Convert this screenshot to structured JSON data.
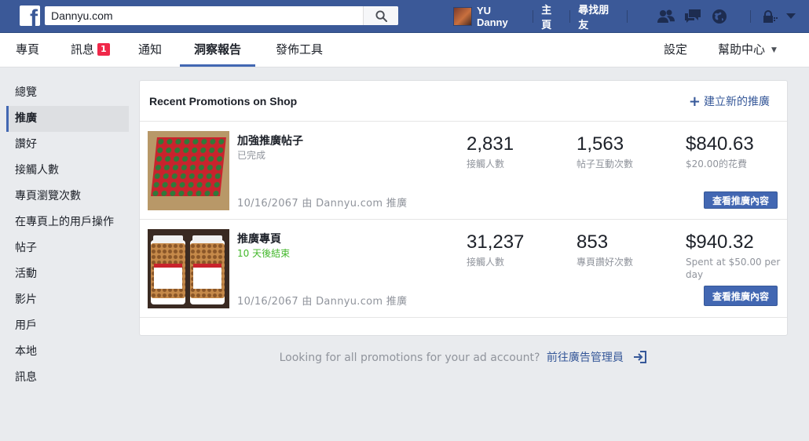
{
  "topbar": {
    "logo": "f",
    "search_value": "Dannyu.com",
    "user_name": "YU Danny",
    "home_label": "主頁",
    "find_friends_label": "尋找朋友"
  },
  "nav": {
    "tabs": [
      "專頁",
      "訊息",
      "通知",
      "洞察報告",
      "發佈工具"
    ],
    "message_badge": "1",
    "settings_label": "設定",
    "help_label": "幫助中心",
    "caret": "▼"
  },
  "sidebar": {
    "items": [
      "總覽",
      "推廣",
      "讚好",
      "接觸人數",
      "專頁瀏覽次數",
      "在專頁上的用戶操作",
      "帖子",
      "活動",
      "影片",
      "用戶",
      "本地",
      "訊息"
    ]
  },
  "card": {
    "title": "Recent Promotions on Shop",
    "create_plus": "+",
    "create_label": "建立新的推廣",
    "promotions": [
      {
        "title": "加強推廣帖子",
        "status": "已完成",
        "date": "10/16/2067 由 Dannyu.com 推廣",
        "reach_value": "2,831",
        "reach_label": "接觸人數",
        "metric2_value": "1,563",
        "metric2_label": "帖子互動次數",
        "spend_value": "$840.63",
        "spend_label": "$20.00的花費",
        "button_label": "查看推廣內容"
      },
      {
        "title": "推廣專頁",
        "status": "10 天後結束",
        "date": "10/16/2067 由 Dannyu.com 推廣",
        "reach_value": "31,237",
        "reach_label": "接觸人數",
        "metric2_value": "853",
        "metric2_label": "專頁讚好次數",
        "spend_value": "$940.32",
        "spend_label": "Spent at $50.00 per day",
        "button_label": "查看推廣內容"
      }
    ]
  },
  "footer": {
    "text": "Looking for all promotions for your ad account?",
    "link": "前往廣告管理員"
  },
  "colors": {
    "brand_blue": "#3b5998",
    "button_blue": "#4267b2",
    "link_blue": "#365899",
    "badge_red": "#f02849",
    "status_green": "#42b72a"
  }
}
